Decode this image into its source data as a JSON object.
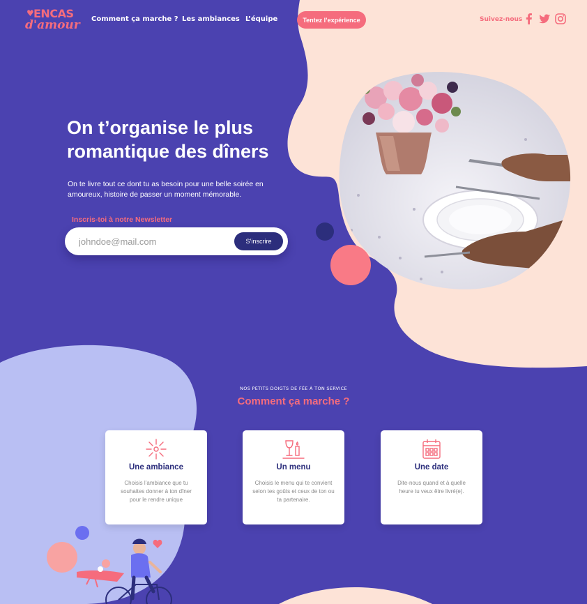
{
  "brand": {
    "line1": "ENCAS",
    "line2": "d'amour"
  },
  "nav": {
    "links": [
      "Comment ça marche ?",
      "Les ambiances",
      "L’équipe"
    ],
    "cta": "Tentez l’expérience",
    "follow": "Suivez-nous",
    "social": [
      "facebook-icon",
      "twitter-icon",
      "instagram-icon"
    ]
  },
  "hero": {
    "title": "On t’organise le plus romantique des dîners",
    "subtitle": "On te livre tout ce dont tu as besoin pour une belle soirée en amoureux, histoire de passer un moment mémorable.",
    "newsletter_label": "Inscris-toi à notre Newsletter",
    "email_placeholder": "johndoe@mail.com",
    "subscribe": "S’inscrire"
  },
  "how": {
    "kicker": "NOS PETITS DOIGTS DE FÉE À TON SERVICE",
    "title": "Comment ça marche ?",
    "cards": [
      {
        "icon": "fireworks-icon",
        "title": "Une ambiance",
        "text": "Choisis l’ambiance que tu souhaites donner à ton dîner pour le rendre unique"
      },
      {
        "icon": "wine-candle-icon",
        "title": "Un menu",
        "text": "Choisis le menu qui te convient selon tes goûts et ceux de ton ou ta partenaire."
      },
      {
        "icon": "calendar-icon",
        "title": "Une date",
        "text": "Dite-nous quand et à quelle heure tu veux être livré(e)."
      }
    ]
  },
  "colors": {
    "purple": "#4b42b0",
    "peach": "#fde3d7",
    "pink": "#f56c7d",
    "navy": "#2c2e7c",
    "lavender": "#b9bff3"
  }
}
